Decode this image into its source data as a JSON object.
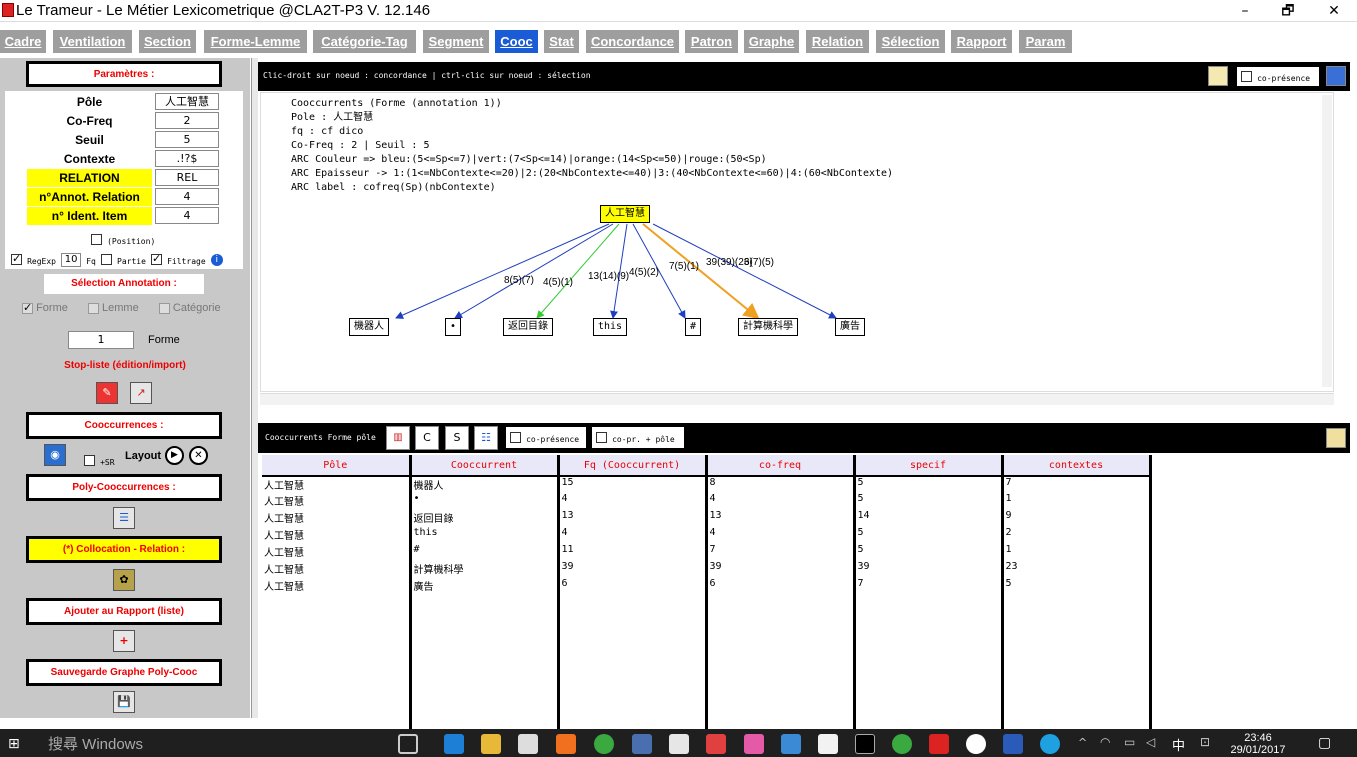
{
  "window": {
    "title": "Le Trameur - Le Métier Lexicometrique @CLA2T-P3 V. 12.146",
    "minimize": "–",
    "maximize": "🗗",
    "close": "✕"
  },
  "tabs": [
    {
      "label": "Cadre"
    },
    {
      "label": "Ventilation"
    },
    {
      "label": "Section"
    },
    {
      "label": "Forme-Lemme"
    },
    {
      "label": "Catégorie-Tag"
    },
    {
      "label": "Segment"
    },
    {
      "label": "Cooc"
    },
    {
      "label": "Stat"
    },
    {
      "label": "Concordance"
    },
    {
      "label": "Patron"
    },
    {
      "label": "Graphe"
    },
    {
      "label": "Relation"
    },
    {
      "label": "Sélection"
    },
    {
      "label": "Rapport"
    },
    {
      "label": "Param"
    }
  ],
  "active_tab": "Cooc",
  "left": {
    "params_header": "Paramètres :",
    "params": [
      {
        "label": "Pôle",
        "value": "人工智慧"
      },
      {
        "label": "Co-Freq",
        "value": "2"
      },
      {
        "label": "Seuil",
        "value": "5"
      },
      {
        "label": "Contexte",
        "value": ".!?$"
      },
      {
        "label": "RELATION",
        "value": "REL"
      },
      {
        "label": "n°Annot. Relation",
        "value": "4"
      },
      {
        "label": "n° Ident. Item",
        "value": "4"
      }
    ],
    "position_label": "(Position)",
    "regexp_label": "RegExp",
    "fq_value": "10",
    "fq_label": "Fq",
    "partie_label": "Partie",
    "filtrage_label": "Filtrage",
    "selection_header": "Sélection Annotation :",
    "forme_label": "Forme",
    "lemme_label": "Lemme",
    "categorie_label": "Catégorie",
    "annot_value": "1",
    "annot_forme_label": "Forme",
    "stoplist_label": "Stop-liste (édition/import)",
    "cooc_header": "Cooccurrences :",
    "sr_label": "+SR",
    "layout_label": "Layout",
    "polycooc_header": "Poly-Cooccurrences :",
    "collocation_header": "(*) Collocation - Relation :",
    "rapport_header": "Ajouter au Rapport (liste)",
    "sauvegarde_header": "Sauvegarde Graphe Poly-Cooc"
  },
  "graph": {
    "hint": "Clic-droit sur noeud : concordance | ctrl-clic sur noeud : sélection",
    "copresence_label": "co-présence",
    "info": [
      "Cooccurrents (Forme (annotation 1))",
      "Pole : 人工智慧",
      "fq : cf dico",
      "Co-Freq : 2 | Seuil : 5",
      "ARC Couleur => bleu:(5<=Sp<=7)|vert:(7<Sp<=14)|orange:(14<Sp<=50)|rouge:(50<Sp)",
      "ARC Epaisseur -> 1:(1<=NbContexte<=20)|2:(20<NbContexte<=40)|3:(40<NbContexte<=60)|4:(60<NbContexte)",
      "ARC label : cofreq(Sp)(nbContexte)"
    ],
    "root": "人工智慧",
    "nodes": [
      "機器人",
      "•",
      "返回目錄",
      "this",
      "#",
      "計算機科學",
      "廣告"
    ],
    "edge_labels": [
      "8(5)(7)",
      "4(5)(1)",
      "13(14)(9)",
      "4(5)(2)",
      "7(5)(1)",
      "39(39)(23)",
      "6(7)(5)"
    ],
    "edge_colors": [
      "#1f3fbf",
      "#1f3fbf",
      "#33cc33",
      "#1f3fbf",
      "#1f3fbf",
      "#f0a020",
      "#1f3fbf"
    ]
  },
  "results": {
    "title": "Cooccurrents Forme pôle",
    "copresence_label": "co-présence",
    "copr_pole_label": "co-pr. + pôle",
    "columns": [
      "Pôle",
      "Cooccurrent",
      "Fq (Cooccurrent)",
      "co-freq",
      "specif",
      "contextes"
    ],
    "rows": [
      [
        "人工智慧",
        "機器人",
        "15",
        "8",
        "5",
        "7"
      ],
      [
        "人工智慧",
        "•",
        "4",
        "4",
        "5",
        "1"
      ],
      [
        "人工智慧",
        "返回目錄",
        "13",
        "13",
        "14",
        "9"
      ],
      [
        "人工智慧",
        "this",
        "4",
        "4",
        "5",
        "2"
      ],
      [
        "人工智慧",
        "#",
        "11",
        "7",
        "5",
        "1"
      ],
      [
        "人工智慧",
        "計算機科學",
        "39",
        "39",
        "39",
        "23"
      ],
      [
        "人工智慧",
        "廣告",
        "6",
        "6",
        "7",
        "5"
      ]
    ]
  },
  "taskbar": {
    "search_placeholder": "搜尋 Windows",
    "ime": "中",
    "time": "23:46",
    "date": "29/01/2017"
  }
}
